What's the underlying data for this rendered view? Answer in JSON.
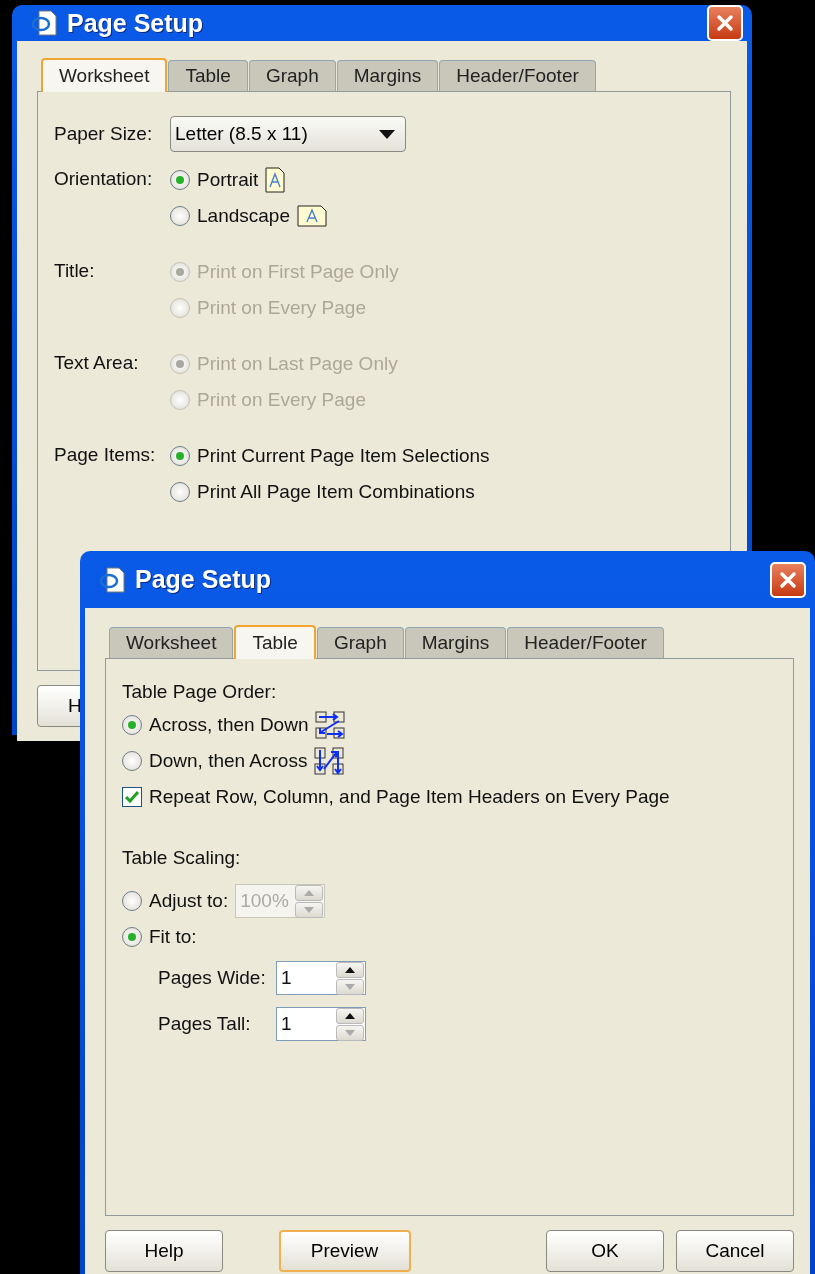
{
  "back_window": {
    "title": "Page Setup",
    "tabs": [
      {
        "label": "Worksheet",
        "selected": true
      },
      {
        "label": "Table",
        "selected": false
      },
      {
        "label": "Graph",
        "selected": false
      },
      {
        "label": "Margins",
        "selected": false
      },
      {
        "label": "Header/Footer",
        "selected": false
      }
    ],
    "paper_size": {
      "label": "Paper Size:",
      "value": "Letter (8.5 x 11)"
    },
    "groups": [
      {
        "label": "Orientation:",
        "options": [
          {
            "label": "Portrait",
            "selected": true,
            "disabled": false,
            "kind": "portrait"
          },
          {
            "label": "Landscape",
            "selected": false,
            "disabled": false,
            "kind": "landscape"
          }
        ]
      },
      {
        "label": "Title:",
        "options": [
          {
            "label": "Print on First Page Only",
            "selected": true,
            "disabled": true
          },
          {
            "label": "Print on Every Page",
            "selected": false,
            "disabled": true
          }
        ]
      },
      {
        "label": "Text Area:",
        "options": [
          {
            "label": "Print on Last Page Only",
            "selected": true,
            "disabled": true
          },
          {
            "label": "Print on Every Page",
            "selected": false,
            "disabled": true
          }
        ]
      },
      {
        "label": "Page Items:",
        "options": [
          {
            "label": "Print Current Page Item Selections",
            "selected": true,
            "disabled": false
          },
          {
            "label": "Print All Page Item Combinations",
            "selected": false,
            "disabled": false
          }
        ]
      }
    ],
    "buttons": [
      {
        "label": "H"
      }
    ]
  },
  "front_window": {
    "title": "Page Setup",
    "tabs": [
      {
        "label": "Worksheet",
        "selected": false
      },
      {
        "label": "Table",
        "selected": true
      },
      {
        "label": "Graph",
        "selected": false
      },
      {
        "label": "Margins",
        "selected": false
      },
      {
        "label": "Header/Footer",
        "selected": false
      }
    ],
    "page_order": {
      "label": "Table Page Order:",
      "options": [
        {
          "label": "Across, then Down",
          "selected": true,
          "kind": "across"
        },
        {
          "label": "Down, then Across",
          "selected": false,
          "kind": "down"
        }
      ]
    },
    "repeat_headers": {
      "label": "Repeat Row, Column, and Page Item Headers on Every Page",
      "checked": true
    },
    "scaling": {
      "label": "Table Scaling:",
      "adjust": {
        "label": "Adjust to:",
        "selected": false,
        "value": "100%",
        "disabled": true
      },
      "fit": {
        "label": "Fit to:",
        "selected": true
      },
      "spinners": [
        {
          "label": "Pages Wide:",
          "value": "1"
        },
        {
          "label": "Pages Tall:",
          "value": "1"
        }
      ]
    },
    "buttons": [
      {
        "label": "Help",
        "focused": false
      },
      {
        "label": "Preview",
        "focused": true
      },
      {
        "label": "OK",
        "focused": false
      },
      {
        "label": "Cancel",
        "focused": false
      }
    ]
  }
}
